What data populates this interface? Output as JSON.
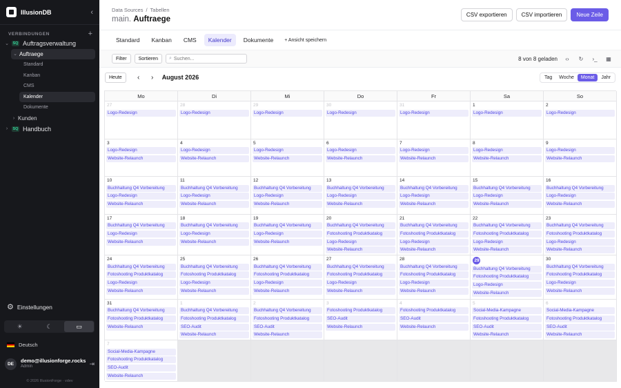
{
  "app": {
    "name": "IllusionDB"
  },
  "sidebar": {
    "section": "VERBINDUNGEN",
    "db": "Auftragsverwaltung",
    "db_badge": "SQ",
    "table": "Auftraege",
    "views": [
      "Standard",
      "Kanban",
      "CMS",
      "Kalender",
      "Dokumente"
    ],
    "table2": "Kunden",
    "db2": "Handbuch",
    "settings": "Einstellungen",
    "language": "Deutsch",
    "user_initials": "DE",
    "user_email": "demo@illusionforge.rocks",
    "user_role": "Admin",
    "footer": "© 2026 IllusionForge · vdev"
  },
  "header": {
    "crumb1": "Data Sources",
    "crumb2": "Tabellen",
    "ns": "main.",
    "title": "Auftraege",
    "btn_export": "CSV exportieren",
    "btn_import": "CSV importieren",
    "btn_new": "Neue Zeile"
  },
  "tabs": [
    "Standard",
    "Kanban",
    "CMS",
    "Kalender",
    "Dokumente"
  ],
  "add_view": "+ Ansicht speichern",
  "toolbar": {
    "filter": "Filter",
    "sort": "Sortieren",
    "search_placeholder": "Suchen...",
    "count": "8 von 8 geladen"
  },
  "calendar": {
    "today": "Heute",
    "month": "August 2026",
    "modes": [
      "Tag",
      "Woche",
      "Monat",
      "Jahr"
    ],
    "weekdays": [
      "Mo",
      "Di",
      "Mi",
      "Do",
      "Fr",
      "Sa",
      "So"
    ],
    "weeks": [
      [
        {
          "d": "27",
          "o": true,
          "e": [
            "Logo-Redesign"
          ]
        },
        {
          "d": "28",
          "o": true,
          "e": [
            "Logo-Redesign"
          ]
        },
        {
          "d": "29",
          "o": true,
          "e": [
            "Logo-Redesign"
          ]
        },
        {
          "d": "30",
          "o": true,
          "e": [
            "Logo-Redesign"
          ]
        },
        {
          "d": "31",
          "o": true,
          "e": [
            "Logo-Redesign"
          ]
        },
        {
          "d": "1",
          "e": [
            "Logo-Redesign"
          ]
        },
        {
          "d": "2",
          "e": [
            "Logo-Redesign"
          ]
        }
      ],
      [
        {
          "d": "3",
          "e": [
            "Logo-Redesign",
            "Website-Relaunch"
          ]
        },
        {
          "d": "4",
          "e": [
            "Logo-Redesign",
            "Website-Relaunch"
          ]
        },
        {
          "d": "5",
          "e": [
            "Logo-Redesign",
            "Website-Relaunch"
          ]
        },
        {
          "d": "6",
          "e": [
            "Logo-Redesign",
            "Website-Relaunch"
          ]
        },
        {
          "d": "7",
          "e": [
            "Logo-Redesign",
            "Website-Relaunch"
          ]
        },
        {
          "d": "8",
          "e": [
            "Logo-Redesign",
            "Website-Relaunch"
          ]
        },
        {
          "d": "9",
          "e": [
            "Logo-Redesign",
            "Website-Relaunch"
          ]
        }
      ],
      [
        {
          "d": "10",
          "e": [
            "Buchhaltung Q4 Vorbereitung",
            "Logo-Redesign",
            "Website-Relaunch"
          ]
        },
        {
          "d": "11",
          "e": [
            "Buchhaltung Q4 Vorbereitung",
            "Logo-Redesign",
            "Website-Relaunch"
          ]
        },
        {
          "d": "12",
          "e": [
            "Buchhaltung Q4 Vorbereitung",
            "Logo-Redesign",
            "Website-Relaunch"
          ]
        },
        {
          "d": "13",
          "e": [
            "Buchhaltung Q4 Vorbereitung",
            "Logo-Redesign",
            "Website-Relaunch"
          ]
        },
        {
          "d": "14",
          "e": [
            "Buchhaltung Q4 Vorbereitung",
            "Logo-Redesign",
            "Website-Relaunch"
          ]
        },
        {
          "d": "15",
          "e": [
            "Buchhaltung Q4 Vorbereitung",
            "Logo-Redesign",
            "Website-Relaunch"
          ]
        },
        {
          "d": "16",
          "e": [
            "Buchhaltung Q4 Vorbereitung",
            "Logo-Redesign",
            "Website-Relaunch"
          ]
        }
      ],
      [
        {
          "d": "17",
          "e": [
            "Buchhaltung Q4 Vorbereitung",
            "Logo-Redesign",
            "Website-Relaunch"
          ]
        },
        {
          "d": "18",
          "e": [
            "Buchhaltung Q4 Vorbereitung",
            "Logo-Redesign",
            "Website-Relaunch"
          ]
        },
        {
          "d": "19",
          "e": [
            "Buchhaltung Q4 Vorbereitung",
            "Logo-Redesign",
            "Website-Relaunch"
          ]
        },
        {
          "d": "20",
          "e": [
            "Buchhaltung Q4 Vorbereitung",
            "Fotoshooting Produktkatalog",
            "Logo-Redesign",
            "Website-Relaunch"
          ]
        },
        {
          "d": "21",
          "e": [
            "Buchhaltung Q4 Vorbereitung",
            "Fotoshooting Produktkatalog",
            "Logo-Redesign",
            "Website-Relaunch"
          ]
        },
        {
          "d": "22",
          "e": [
            "Buchhaltung Q4 Vorbereitung",
            "Fotoshooting Produktkatalog",
            "Logo-Redesign",
            "Website-Relaunch"
          ]
        },
        {
          "d": "23",
          "e": [
            "Buchhaltung Q4 Vorbereitung",
            "Fotoshooting Produktkatalog",
            "Logo-Redesign",
            "Website-Relaunch"
          ]
        }
      ],
      [
        {
          "d": "24",
          "e": [
            "Buchhaltung Q4 Vorbereitung",
            "Fotoshooting Produktkatalog",
            "Logo-Redesign",
            "Website-Relaunch"
          ]
        },
        {
          "d": "25",
          "e": [
            "Buchhaltung Q4 Vorbereitung",
            "Fotoshooting Produktkatalog",
            "Logo-Redesign",
            "Website-Relaunch"
          ]
        },
        {
          "d": "26",
          "e": [
            "Buchhaltung Q4 Vorbereitung",
            "Fotoshooting Produktkatalog",
            "Logo-Redesign",
            "Website-Relaunch"
          ]
        },
        {
          "d": "27",
          "e": [
            "Buchhaltung Q4 Vorbereitung",
            "Fotoshooting Produktkatalog",
            "Logo-Redesign",
            "Website-Relaunch"
          ]
        },
        {
          "d": "28",
          "e": [
            "Buchhaltung Q4 Vorbereitung",
            "Fotoshooting Produktkatalog",
            "Logo-Redesign",
            "Website-Relaunch"
          ]
        },
        {
          "d": "29",
          "t": true,
          "e": [
            "Buchhaltung Q4 Vorbereitung",
            "Fotoshooting Produktkatalog",
            "Logo-Redesign",
            "Website-Relaunch"
          ]
        },
        {
          "d": "30",
          "e": [
            "Buchhaltung Q4 Vorbereitung",
            "Fotoshooting Produktkatalog",
            "Logo-Redesign",
            "Website-Relaunch"
          ]
        }
      ],
      [
        {
          "d": "31",
          "e": [
            "Buchhaltung Q4 Vorbereitung",
            "Fotoshooting Produktkatalog",
            "Website-Relaunch"
          ]
        },
        {
          "d": "1",
          "o": true,
          "e": [
            "Buchhaltung Q4 Vorbereitung",
            "Fotoshooting Produktkatalog",
            "SEO-Audit",
            "Website-Relaunch"
          ]
        },
        {
          "d": "2",
          "o": true,
          "e": [
            "Buchhaltung Q4 Vorbereitung",
            "Fotoshooting Produktkatalog",
            "SEO-Audit",
            "Website-Relaunch"
          ]
        },
        {
          "d": "3",
          "o": true,
          "e": [
            "Fotoshooting Produktkatalog",
            "SEO-Audit",
            "Website-Relaunch"
          ]
        },
        {
          "d": "4",
          "o": true,
          "e": [
            "Fotoshooting Produktkatalog",
            "SEO-Audit",
            "Website-Relaunch"
          ]
        },
        {
          "d": "5",
          "o": true,
          "e": [
            "Social-Media-Kampagne",
            "Fotoshooting Produktkatalog",
            "SEO-Audit",
            "Website-Relaunch"
          ]
        },
        {
          "d": "6",
          "o": true,
          "e": [
            "Social-Media-Kampagne",
            "Fotoshooting Produktkatalog",
            "SEO-Audit",
            "Website-Relaunch"
          ]
        }
      ],
      [
        {
          "d": "7",
          "o": true,
          "e": [
            "Social-Media-Kampagne",
            "Fotoshooting Produktkatalog",
            "SEO-Audit",
            "Website-Relaunch"
          ]
        }
      ]
    ]
  }
}
